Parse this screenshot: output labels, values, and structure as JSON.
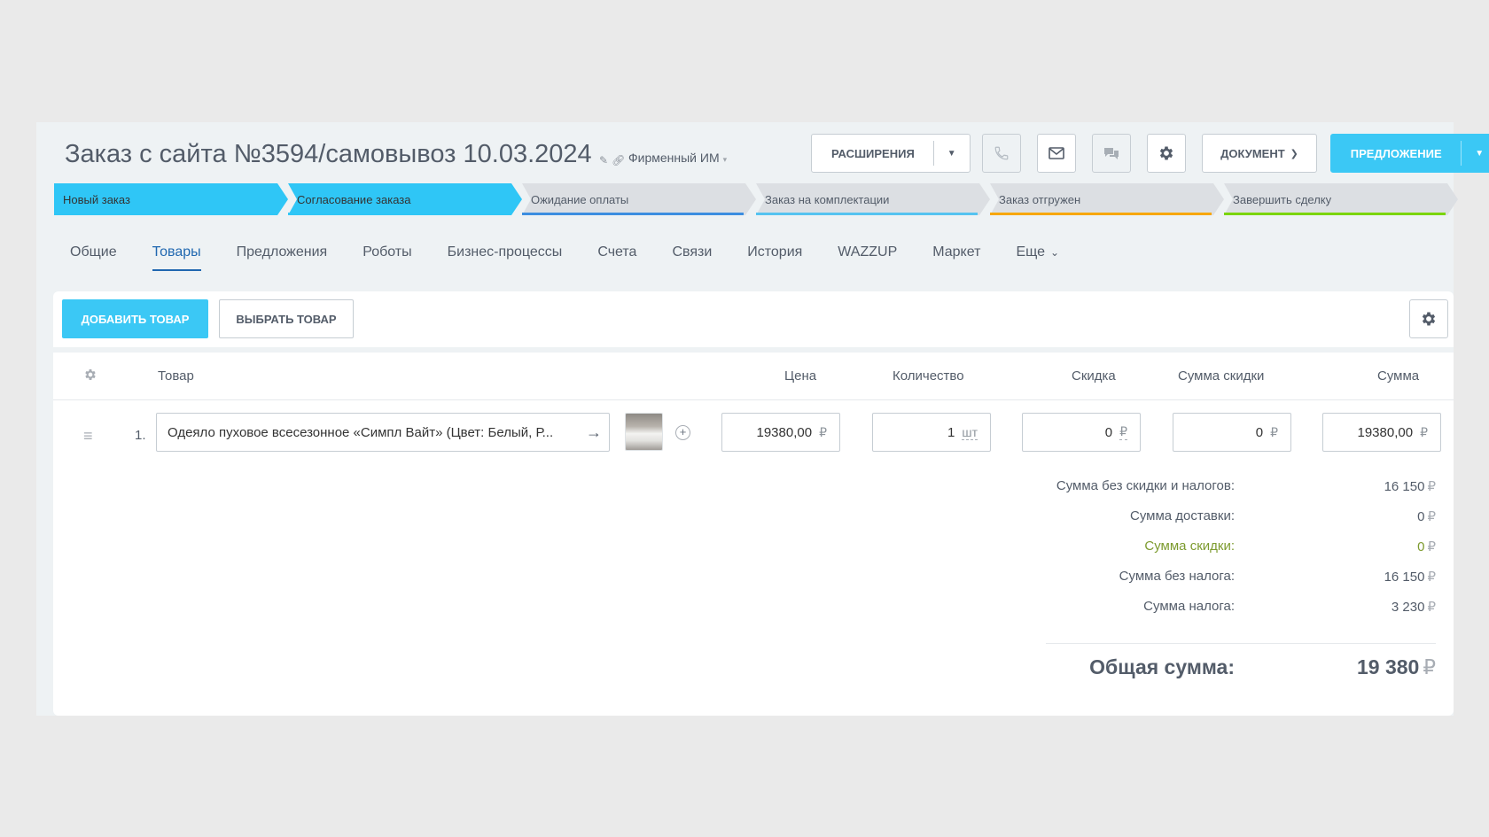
{
  "header": {
    "title": "Заказ с сайта №3594/самовывоз 10.03.2024",
    "category": "Фирменный ИМ",
    "buttons": {
      "extensions": "РАСШИРЕНИЯ",
      "document": "ДОКУМЕНТ",
      "proposal": "ПРЕДЛОЖЕНИЕ"
    }
  },
  "stages": [
    {
      "label": "Новый заказ",
      "bg": "#2fc6f6",
      "bar": "#2fc6f6"
    },
    {
      "label": "Согласование заказа",
      "bg": "#2fc6f6",
      "bar": "#2fc6f6"
    },
    {
      "label": "Ожидание оплаты",
      "bg": "#dcdfe3",
      "bar": "#3c8ee0"
    },
    {
      "label": "Заказ на комплектации",
      "bg": "#dcdfe3",
      "bar": "#55c3f0"
    },
    {
      "label": "Заказ отгружен",
      "bg": "#dcdfe3",
      "bar": "#f7a700"
    },
    {
      "label": "Завершить сделку",
      "bg": "#dcdfe3",
      "bar": "#7bd500"
    }
  ],
  "tabs": [
    "Общие",
    "Товары",
    "Предложения",
    "Роботы",
    "Бизнес-процессы",
    "Счета",
    "Связи",
    "История",
    "WAZZUP",
    "Маркет",
    "Еще"
  ],
  "toolbar": {
    "add_label": "ДОБАВИТЬ ТОВАР",
    "pick_label": "ВЫБРАТЬ ТОВАР"
  },
  "columns": {
    "product": "Товар",
    "price": "Цена",
    "quantity": "Количество",
    "discount": "Скидка",
    "discount_sum": "Сумма скидки",
    "sum": "Сумма"
  },
  "rows": [
    {
      "num": "1.",
      "name": "Одеяло пуховое всесезонное «Симпл Вайт» (Цвет: Белый, Р...",
      "price": "19380,00",
      "quantity": "1",
      "unit": "шт",
      "discount": "0",
      "discount_sum": "0",
      "sum": "19380,00",
      "currency": "₽"
    }
  ],
  "totals": {
    "rows": [
      {
        "label": "Сумма без скидки и налогов:",
        "value": "16 150"
      },
      {
        "label": "Сумма доставки:",
        "value": "0"
      },
      {
        "label": "Сумма скидки:",
        "value": "0"
      },
      {
        "label": "Сумма без налога:",
        "value": "16 150"
      },
      {
        "label": "Сумма налога:",
        "value": "3 230"
      }
    ],
    "grand_label": "Общая сумма:",
    "grand_value": "19 380",
    "currency": "₽"
  },
  "colors": {
    "accent": "#3bc8f5",
    "tab_active": "#2067b0",
    "discount_text": "#7d9b2f"
  }
}
